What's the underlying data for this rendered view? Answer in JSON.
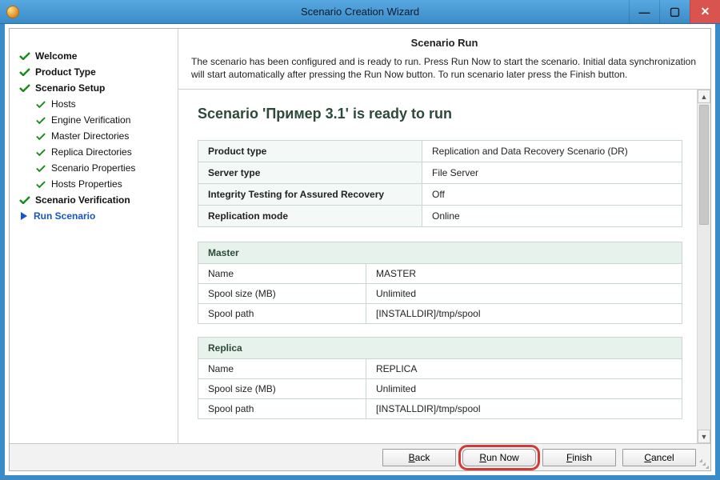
{
  "window": {
    "title": "Scenario Creation Wizard"
  },
  "sidebar": {
    "items": [
      {
        "label": "Welcome",
        "type": "step",
        "done": true
      },
      {
        "label": "Product Type",
        "type": "step",
        "done": true
      },
      {
        "label": "Scenario Setup",
        "type": "step",
        "done": true
      },
      {
        "label": "Hosts",
        "type": "sub",
        "done": true
      },
      {
        "label": "Engine Verification",
        "type": "sub",
        "done": true
      },
      {
        "label": "Master Directories",
        "type": "sub",
        "done": true
      },
      {
        "label": "Replica Directories",
        "type": "sub",
        "done": true
      },
      {
        "label": "Scenario Properties",
        "type": "sub",
        "done": true
      },
      {
        "label": "Hosts Properties",
        "type": "sub",
        "done": true
      },
      {
        "label": "Scenario Verification",
        "type": "step",
        "done": true
      },
      {
        "label": "Run Scenario",
        "type": "current",
        "done": false
      }
    ]
  },
  "header": {
    "title": "Scenario Run",
    "description": "The scenario has been configured and is ready to run. Press Run Now to start the scenario. Initial data synchronization will start automatically after pressing the Run Now button. To run scenario later press the Finish button."
  },
  "ready_heading": "Scenario 'Пример 3.1' is ready to run",
  "summary_rows": [
    {
      "key": "Product type",
      "value": "Replication and Data Recovery Scenario (DR)"
    },
    {
      "key": "Server type",
      "value": "File Server"
    },
    {
      "key": "Integrity Testing for Assured Recovery",
      "value": "Off"
    },
    {
      "key": "Replication mode",
      "value": "Online"
    }
  ],
  "master": {
    "title": "Master",
    "rows": [
      {
        "key": "Name",
        "value": "MASTER"
      },
      {
        "key": "Spool size (MB)",
        "value": "Unlimited"
      },
      {
        "key": "Spool path",
        "value": "[INSTALLDIR]/tmp/spool"
      }
    ]
  },
  "replica": {
    "title": "Replica",
    "rows": [
      {
        "key": "Name",
        "value": "REPLICA"
      },
      {
        "key": "Spool size (MB)",
        "value": "Unlimited"
      },
      {
        "key": "Spool path",
        "value": "[INSTALLDIR]/tmp/spool"
      }
    ]
  },
  "footer": {
    "back": "Back",
    "runnow": "Run Now",
    "finish": "Finish",
    "cancel": "Cancel"
  }
}
